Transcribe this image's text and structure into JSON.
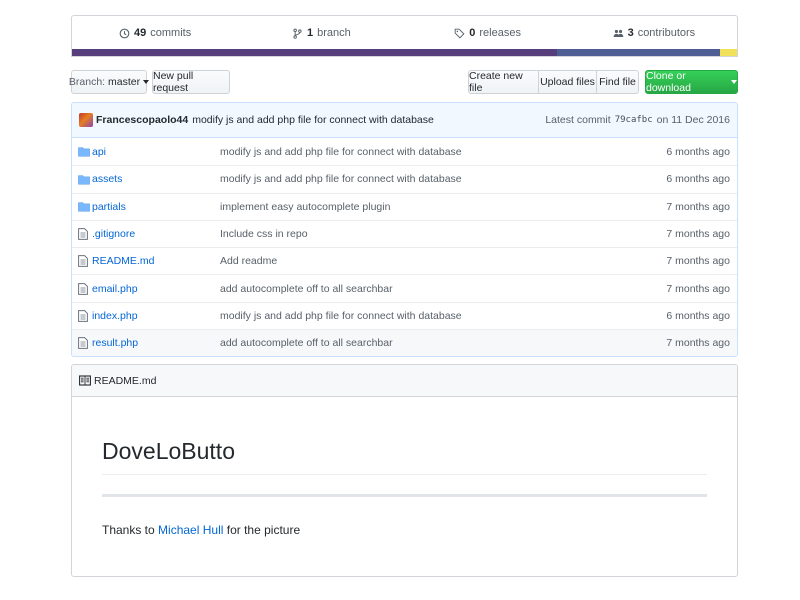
{
  "summary": {
    "commits": {
      "count": "49",
      "label": "commits",
      "icon": "history-icon"
    },
    "branches": {
      "count": "1",
      "label": "branch",
      "icon": "branch-icon"
    },
    "releases": {
      "count": "0",
      "label": "releases",
      "icon": "tag-icon"
    },
    "contributors": {
      "count": "3",
      "label": "contributors",
      "icon": "people-icon"
    }
  },
  "language_bar": [
    {
      "color": "#563d7c",
      "share": 0.73
    },
    {
      "color": "#4F5D95",
      "share": 0.245
    },
    {
      "color": "#f1e05a",
      "share": 0.025
    }
  ],
  "toolbar": {
    "branch_prefix": "Branch:",
    "branch_value": "master",
    "new_pull_request": "New pull request",
    "create_new_file": "Create new file",
    "upload_files": "Upload files",
    "find_file": "Find file",
    "clone_or_download": "Clone or download"
  },
  "latest_commit": {
    "author": "Francescopaolo44",
    "message": "modify js and add php file for connect with database",
    "prefix": "Latest commit",
    "sha": "79cafbc",
    "date_text": "on 11 Dec 2016"
  },
  "files": [
    {
      "type": "folder",
      "name": "api",
      "message": "modify js and add php file for connect with database",
      "age": "6 months ago"
    },
    {
      "type": "folder",
      "name": "assets",
      "message": "modify js and add php file for connect with database",
      "age": "6 months ago"
    },
    {
      "type": "folder",
      "name": "partials",
      "message": "implement easy autocomplete plugin",
      "age": "7 months ago"
    },
    {
      "type": "file",
      "name": ".gitignore",
      "message": "Include css in repo",
      "age": "7 months ago"
    },
    {
      "type": "file",
      "name": "README.md",
      "message": "Add readme",
      "age": "7 months ago"
    },
    {
      "type": "file",
      "name": "email.php",
      "message": "add autocomplete off to all searchbar",
      "age": "7 months ago"
    },
    {
      "type": "file",
      "name": "index.php",
      "message": "modify js and add php file for connect with database",
      "age": "6 months ago"
    },
    {
      "type": "file",
      "name": "result.php",
      "message": "add autocomplete off to all searchbar",
      "age": "7 months ago"
    }
  ],
  "readme": {
    "header": "README.md",
    "title": "DoveLoButto",
    "text_before": "Thanks to",
    "link_text": "Michael Hull",
    "text_after": "for the picture"
  },
  "colors": {
    "link": "#0366d6",
    "green_button": "#28a745",
    "folder_icon": "#79b8ff"
  }
}
